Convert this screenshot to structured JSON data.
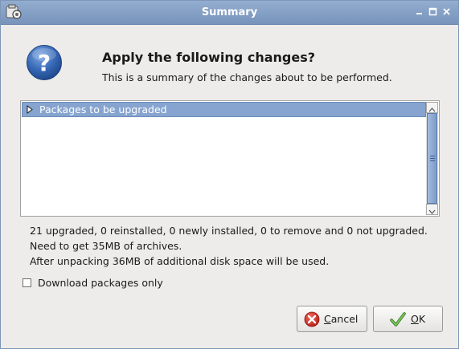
{
  "window": {
    "title": "Summary"
  },
  "header": {
    "heading": "Apply the following changes?",
    "subheading": "This is a summary of the changes about to be performed.",
    "icon": "question-icon"
  },
  "tree": {
    "rows": [
      {
        "label": "Packages to be upgraded",
        "expanded": false,
        "selected": true
      }
    ]
  },
  "summary": {
    "line1": "21 upgraded, 0 reinstalled, 0 newly installed, 0 to remove and 0 not upgraded.",
    "line2": "Need to get 35MB of archives.",
    "line3": "After unpacking 36MB of additional disk space will be used."
  },
  "options": {
    "download_only_label": "Download packages only",
    "download_only_checked": false
  },
  "buttons": {
    "cancel": {
      "mnemonic": "C",
      "rest": "ancel",
      "icon": "cancel-icon"
    },
    "ok": {
      "mnemonic": "O",
      "rest": "K",
      "icon": "checkmark-icon"
    }
  },
  "colors": {
    "titlebar": "#8aa5cb",
    "selection": "#86a4cf",
    "background": "#edecea"
  }
}
